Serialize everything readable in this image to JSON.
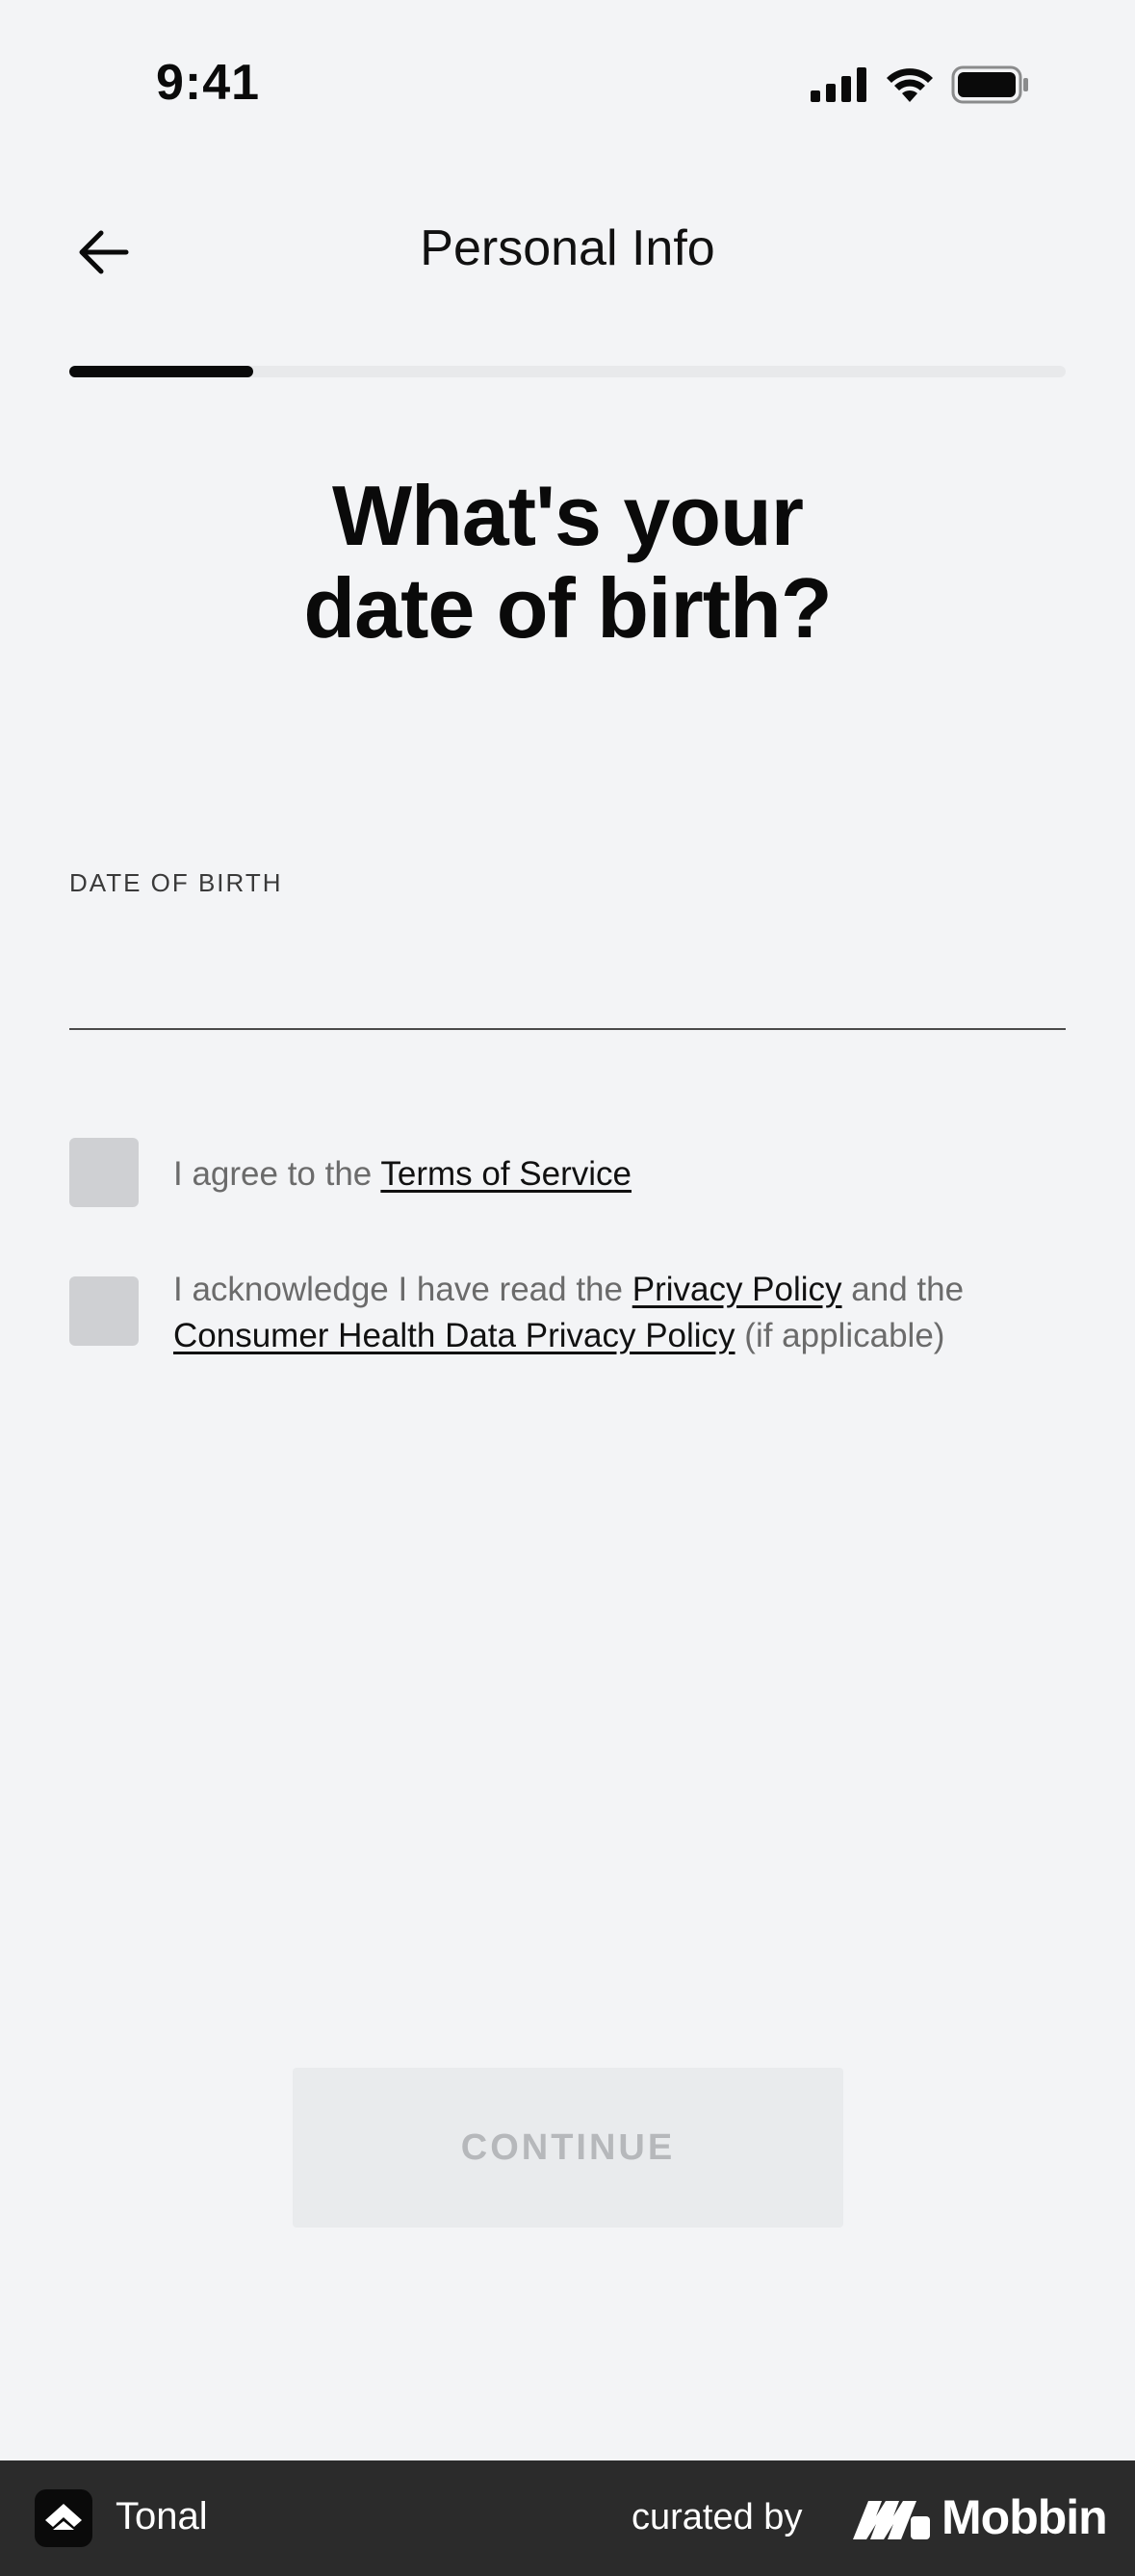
{
  "status_bar": {
    "time": "9:41",
    "icons": [
      "cellular-signal-icon",
      "wifi-icon",
      "battery-icon"
    ]
  },
  "header": {
    "back_icon": "arrow-left-icon",
    "title": "Personal Info"
  },
  "progress": {
    "fraction": 0.185
  },
  "question": {
    "line1": "What's your",
    "line2": "date of birth?"
  },
  "dob_field": {
    "label": "DATE OF BIRTH",
    "value": ""
  },
  "terms": {
    "prefix": "I agree to the ",
    "link": "Terms of Service"
  },
  "privacy": {
    "prefix": "I acknowledge I have read the ",
    "link1": "Privacy Policy",
    "middle": " and the",
    "link2": "Consumer Health Data Privacy Policy",
    "suffix": " (if applicable)"
  },
  "continue_button": {
    "label": "CONTINUE"
  },
  "footer": {
    "app_name": "Tonal",
    "curated_by": "curated by",
    "brand": "Mobbin"
  },
  "colors": {
    "background": "#f3f4f6",
    "progress_fill": "#0a0a0a",
    "progress_track": "#e8e9eb",
    "checkbox": "#cfd0d3",
    "button_disabled_bg": "#e9ebed",
    "button_disabled_text": "#b6b8bb",
    "footer_bg": "#2b2b2b"
  }
}
